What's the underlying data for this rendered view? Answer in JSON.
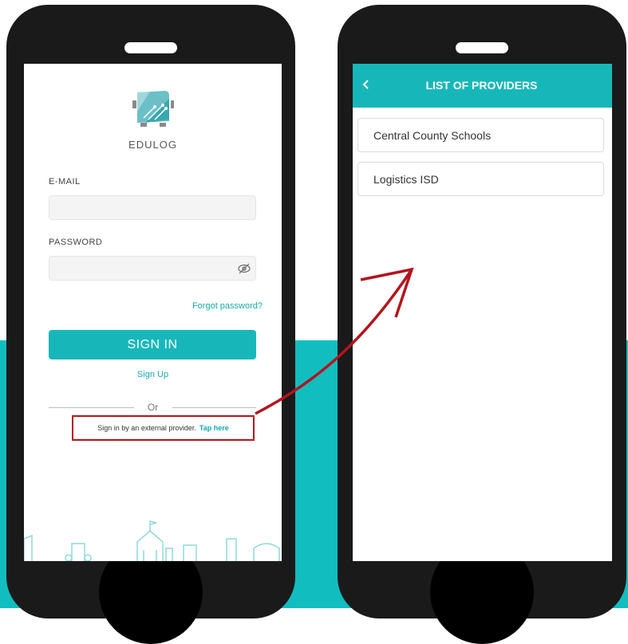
{
  "login": {
    "brand": "EDULOG",
    "email_label": "E-MAIL",
    "password_label": "PASSWORD",
    "forgot_password": "Forgot password?",
    "sign_in": "SIGN IN",
    "sign_up": "Sign Up",
    "or": "Or",
    "external_text": "Sign in by an external provider.",
    "tap_here": "Tap here"
  },
  "providers": {
    "title": "LIST OF PROVIDERS",
    "items": [
      {
        "label": "Central County Schools"
      },
      {
        "label": "Logistics ISD"
      }
    ]
  },
  "colors": {
    "teal": "#12bdbf",
    "accent_text": "#17a9ad",
    "highlight_red": "#b3141d"
  },
  "icons": [
    "edulog-logo",
    "eye-icon",
    "back-chevron-icon",
    "arrow-icon",
    "city-skyline"
  ]
}
